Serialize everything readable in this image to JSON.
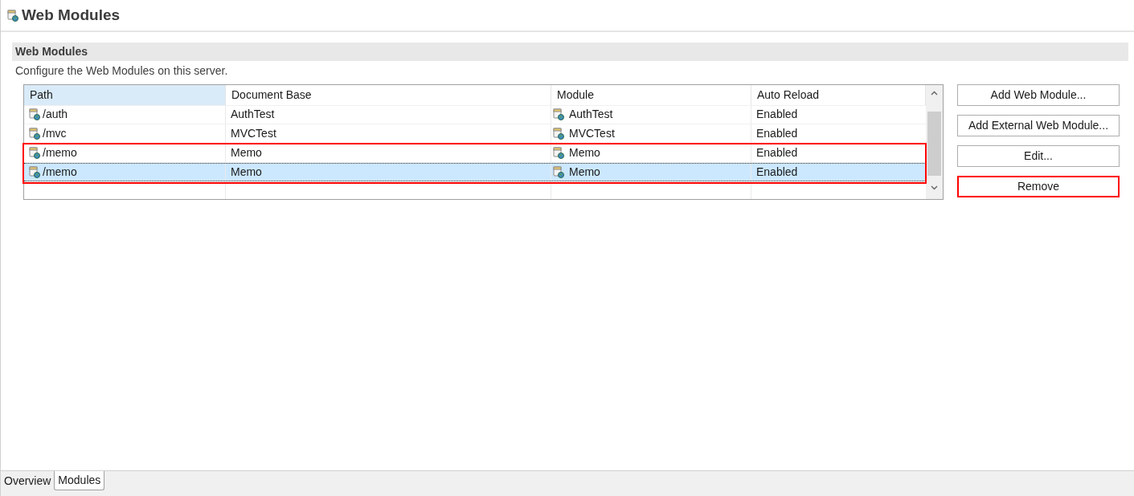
{
  "page": {
    "title": "Web Modules"
  },
  "section": {
    "title": "Web Modules",
    "description": "Configure the Web Modules on this server."
  },
  "table": {
    "columns": [
      {
        "label": "Path",
        "sorted": true
      },
      {
        "label": "Document Base",
        "sorted": false
      },
      {
        "label": "Module",
        "sorted": false
      },
      {
        "label": "Auto Reload",
        "sorted": false
      }
    ],
    "rows": [
      {
        "path": "/auth",
        "document_base": "AuthTest",
        "module": "AuthTest",
        "auto_reload": "Enabled",
        "selected": false,
        "highlighted": false
      },
      {
        "path": "/mvc",
        "document_base": "MVCTest",
        "module": "MVCTest",
        "auto_reload": "Enabled",
        "selected": false,
        "highlighted": false
      },
      {
        "path": "/memo",
        "document_base": "Memo",
        "module": "Memo",
        "auto_reload": "Enabled",
        "selected": false,
        "highlighted": true
      },
      {
        "path": "/memo",
        "document_base": "Memo",
        "module": "Memo",
        "auto_reload": "Enabled",
        "selected": true,
        "highlighted": true
      }
    ]
  },
  "buttons": [
    {
      "label": "Add Web Module...",
      "highlighted": false
    },
    {
      "label": "Add External Web Module...",
      "highlighted": false
    },
    {
      "label": "Edit...",
      "highlighted": false
    },
    {
      "label": "Remove",
      "highlighted": true
    }
  ],
  "tabs": [
    {
      "label": "Overview",
      "selected": false
    },
    {
      "label": "Modules",
      "selected": true
    }
  ]
}
